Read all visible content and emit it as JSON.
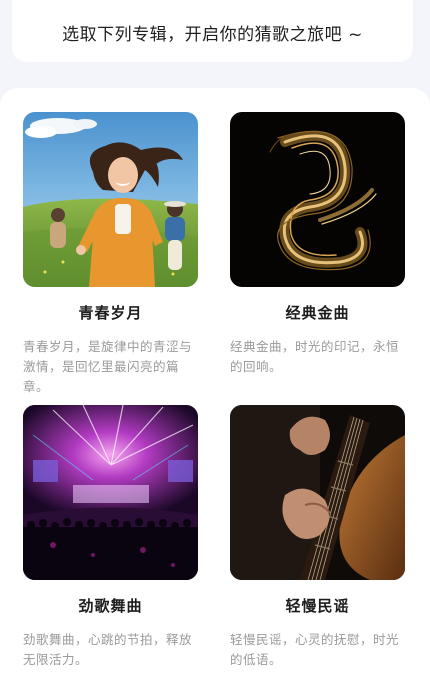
{
  "header": {
    "prompt": "选取下列专辑，开启你的猜歌之旅吧 ~"
  },
  "albums": [
    {
      "title": "青春岁月",
      "description": "青春岁月，是旋律中的青涩与激情，是回忆里最闪亮的篇章。",
      "cover": "youth-field-photo"
    },
    {
      "title": "经典金曲",
      "description": "经典金曲，时光的印记，永恒的回响。",
      "cover": "golden-spiral-art"
    },
    {
      "title": "劲歌舞曲",
      "description": "劲歌舞曲，心跳的节拍，释放无限活力。",
      "cover": "concert-stage-photo"
    },
    {
      "title": "轻慢民谣",
      "description": "轻慢民谣，心灵的抚慰，时光的低语。",
      "cover": "acoustic-guitar-photo"
    }
  ]
}
